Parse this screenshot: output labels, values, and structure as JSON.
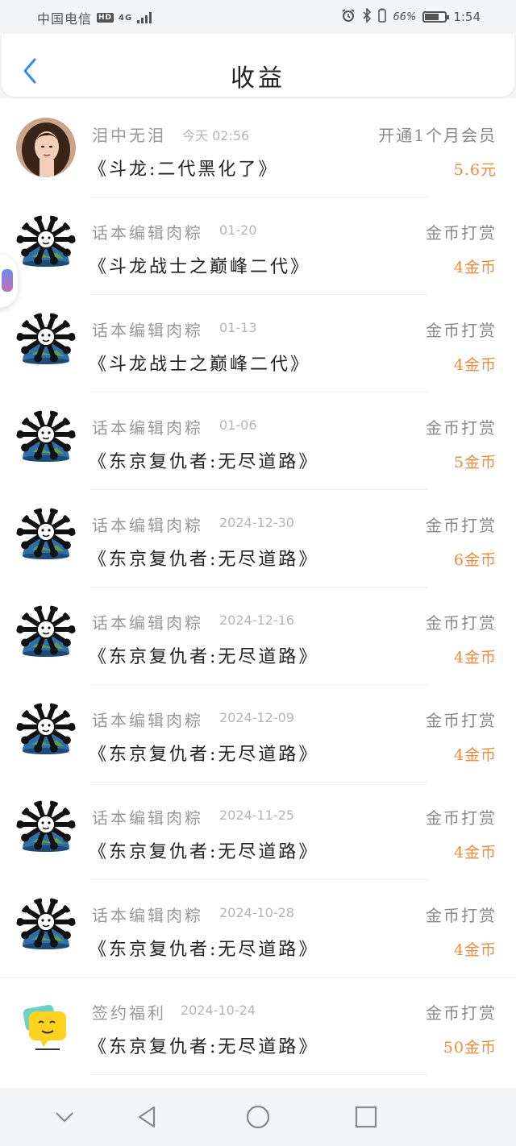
{
  "status_bar": {
    "carrier": "中国电信",
    "hd": "HD",
    "network": "4G",
    "battery": "66%",
    "battery_level": 0.66,
    "time": "1:54"
  },
  "header": {
    "back_icon": "chevron-left-icon",
    "title": "收益"
  },
  "colors": {
    "accent": "#2e8ff0",
    "amount": "#f0893a"
  },
  "items": [
    {
      "name": "泪中无泪",
      "date": "今天 02:56",
      "type": "开通1个月会员",
      "book": "《斗龙:二代黑化了》",
      "amount": "5.6元",
      "avatar": "portrait"
    },
    {
      "name": "话本编辑肉粽",
      "date": "01-20",
      "type": "金币打赏",
      "book": "《斗龙战士之巅峰二代》",
      "amount": "4金币",
      "avatar": "globe-bones"
    },
    {
      "name": "话本编辑肉粽",
      "date": "01-13",
      "type": "金币打赏",
      "book": "《斗龙战士之巅峰二代》",
      "amount": "4金币",
      "avatar": "globe-bones"
    },
    {
      "name": "话本编辑肉粽",
      "date": "01-06",
      "type": "金币打赏",
      "book": "《东京复仇者:无尽道路》",
      "amount": "5金币",
      "avatar": "globe-bones"
    },
    {
      "name": "话本编辑肉粽",
      "date": "2024-12-30",
      "type": "金币打赏",
      "book": "《东京复仇者:无尽道路》",
      "amount": "6金币",
      "avatar": "globe-bones"
    },
    {
      "name": "话本编辑肉粽",
      "date": "2024-12-16",
      "type": "金币打赏",
      "book": "《东京复仇者:无尽道路》",
      "amount": "4金币",
      "avatar": "globe-bones"
    },
    {
      "name": "话本编辑肉粽",
      "date": "2024-12-09",
      "type": "金币打赏",
      "book": "《东京复仇者:无尽道路》",
      "amount": "4金币",
      "avatar": "globe-bones"
    },
    {
      "name": "话本编辑肉粽",
      "date": "2024-11-25",
      "type": "金币打赏",
      "book": "《东京复仇者:无尽道路》",
      "amount": "4金币",
      "avatar": "globe-bones"
    },
    {
      "name": "话本编辑肉粽",
      "date": "2024-10-28",
      "type": "金币打赏",
      "book": "《东京复仇者:无尽道路》",
      "amount": "4金币",
      "avatar": "globe-bones"
    },
    {
      "name": "签约福利",
      "date": "2024-10-24",
      "type": "金币打赏",
      "book": "《东京复仇者:无尽道路》",
      "amount": "50金币",
      "avatar": "chat-bubble"
    }
  ],
  "nav_bar": {
    "icons": [
      "chevron-down-icon",
      "back-triangle-icon",
      "home-circle-icon",
      "recents-square-icon"
    ]
  }
}
